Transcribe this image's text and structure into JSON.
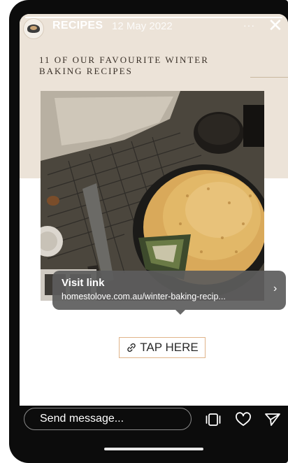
{
  "story": {
    "account": "RECIPES",
    "date": "12 May 2022",
    "more_label": "···",
    "close_label": "✕",
    "progress_fraction": 1.0,
    "headline": "11 OF OUR FAVOURITE WINTER BAKING RECIPES"
  },
  "link_sticker": {
    "title": "Visit link",
    "url": "homestolove.com.au/winter-baking-recip...",
    "chevron": "›"
  },
  "cta": {
    "label": "TAP HERE",
    "icon": "link-icon"
  },
  "reply_bar": {
    "placeholder": "Send message...",
    "icons": [
      "sticker-icon",
      "heart-icon",
      "send-icon"
    ]
  },
  "colors": {
    "beige_background": "#ece3d8",
    "tooltip_background": "#5c5c5c",
    "cta_border": "#e0b48a"
  }
}
